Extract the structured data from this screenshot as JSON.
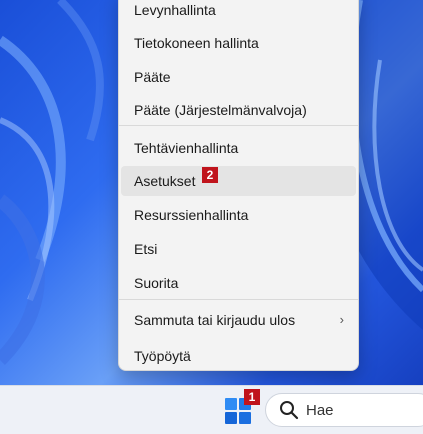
{
  "menu": {
    "items": [
      {
        "label": "Levynhallinta"
      },
      {
        "label": "Tietokoneen hallinta"
      },
      {
        "label": "Pääte"
      },
      {
        "label": "Pääte (Järjestelmänvalvoja)"
      },
      {
        "label": "Tehtävienhallinta"
      },
      {
        "label": "Asetukset"
      },
      {
        "label": "Resurssienhallinta"
      },
      {
        "label": "Etsi"
      },
      {
        "label": "Suorita"
      },
      {
        "label": "Sammuta tai kirjaudu ulos"
      },
      {
        "label": "Työpöytä"
      }
    ],
    "submenu_arrow": "›"
  },
  "badges": {
    "start": "1",
    "settings": "2"
  },
  "taskbar": {
    "search_placeholder": "Hae",
    "icons": [
      "windows-start-icon",
      "search-icon"
    ]
  },
  "colors": {
    "badge": "#c0141c",
    "start_accent": "#1a73e8"
  }
}
